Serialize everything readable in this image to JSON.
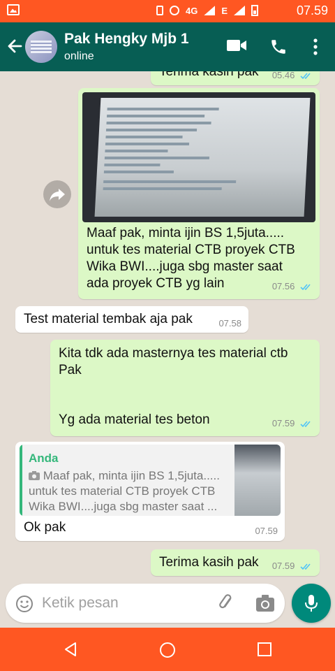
{
  "status_bar": {
    "time": "07.59",
    "network": "4G",
    "network2": "E"
  },
  "header": {
    "contact_name": "Pak Hengky Mjb 1",
    "status": "online"
  },
  "messages": [
    {
      "direction": "out",
      "text": "Terima kasih pak",
      "time": "05.46",
      "read": true
    },
    {
      "direction": "out",
      "type": "image",
      "caption": "Maaf pak, minta ijin BS 1,5juta.....\nuntuk tes material CTB proyek CTB\nWika BWI....juga sbg master saat\nada proyek CTB yg lain",
      "time": "07.56",
      "read": true
    },
    {
      "direction": "in",
      "text": "Test material tembak aja pak",
      "time": "07.58"
    },
    {
      "direction": "out",
      "text": "Kita tdk ada masternya tes material ctb\nPak",
      "text2": "Yg ada material tes beton",
      "time": "07.59",
      "read": true
    },
    {
      "direction": "in",
      "quote_author": "Anda",
      "quote_text": "Maaf pak, minta ijin BS 1,5juta.....\nuntuk tes material CTB proyek CTB\nWika BWI....juga sbg master saat ...",
      "text": "Ok pak",
      "time": "07.59"
    },
    {
      "direction": "out",
      "text": "Terima kasih pak",
      "time": "07.59",
      "read": true
    }
  ],
  "input": {
    "placeholder": "Ketik pesan",
    "value": ""
  },
  "colors": {
    "header": "#075e54",
    "system_bars": "#ff5722",
    "outgoing": "#dcf8c6",
    "incoming": "#ffffff",
    "accent": "#00897b",
    "read_ticks": "#4fc3f7"
  }
}
